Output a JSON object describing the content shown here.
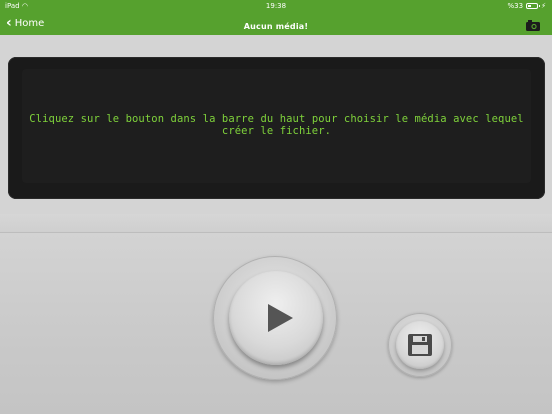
{
  "status_bar": {
    "device": "iPad",
    "time": "19:38",
    "battery": "%33",
    "battery_level": 0.33
  },
  "nav": {
    "back_label": "Home",
    "title": "Aucun média!",
    "camera_icon": "camera-icon"
  },
  "message": {
    "text": "Cliquez sur le bouton dans la barre du haut pour choisir le média avec lequel créer le fichier."
  },
  "controls": {
    "play_icon": "play-icon",
    "save_icon": "floppy-disk-icon"
  },
  "colors": {
    "accent": "#56a12e",
    "message_text": "#7fd23b",
    "panel_bg": "#1a1a1a"
  }
}
